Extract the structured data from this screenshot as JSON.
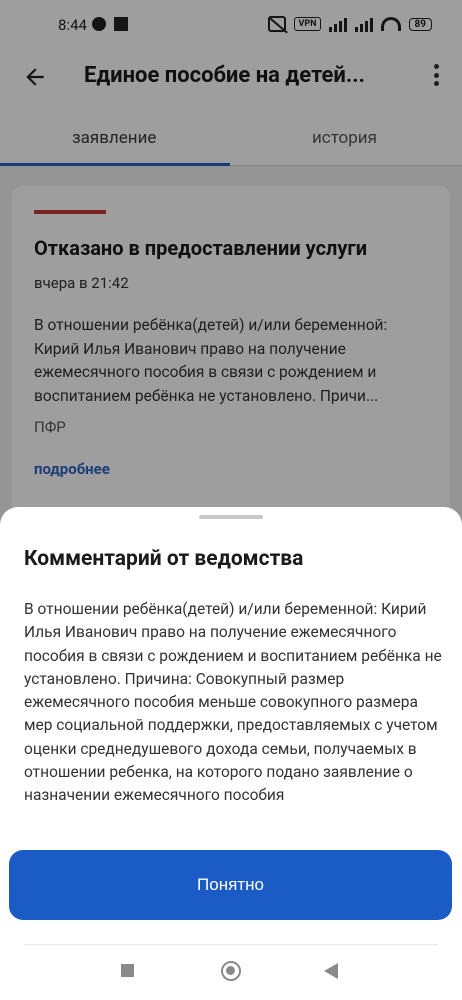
{
  "status_bar": {
    "time": "8:44",
    "vpn_label": "VPN",
    "battery": "89"
  },
  "app_bar": {
    "title": "Единое пособие на детей..."
  },
  "tabs": [
    {
      "label": "заявление",
      "active": true
    },
    {
      "label": "история",
      "active": false
    }
  ],
  "card": {
    "title": "Отказано в предоставлении услуги",
    "time": "вчера в 21:42",
    "text": "В отношении ребёнка(детей) и/или беременной: Кирий Илья Иванович право на получение ежемесячного пособия в связи с рождением и воспитанием ребёнка не установлено. Причи...",
    "source": "ПФР",
    "link": "подробнее",
    "status_color": "#c93a3a"
  },
  "sheet": {
    "title": "Комментарий от ведомства",
    "text": "В отношении ребёнка(детей) и/или беременной: Кирий Илья Иванович право на получение ежемесячного пособия в связи с рождением и воспитанием ребёнка не установлено. Причина: Совокупный размер ежемесячного пособия меньше совокупного размера мер социальной поддержки, предоставляемых с учетом оценки среднедушевого дохода семьи, получаемых в отношении ребенка, на которого подано заявление о назначении ежемесячного пособия",
    "button_label": "Понятно",
    "accent_color": "#1a5bc6"
  }
}
